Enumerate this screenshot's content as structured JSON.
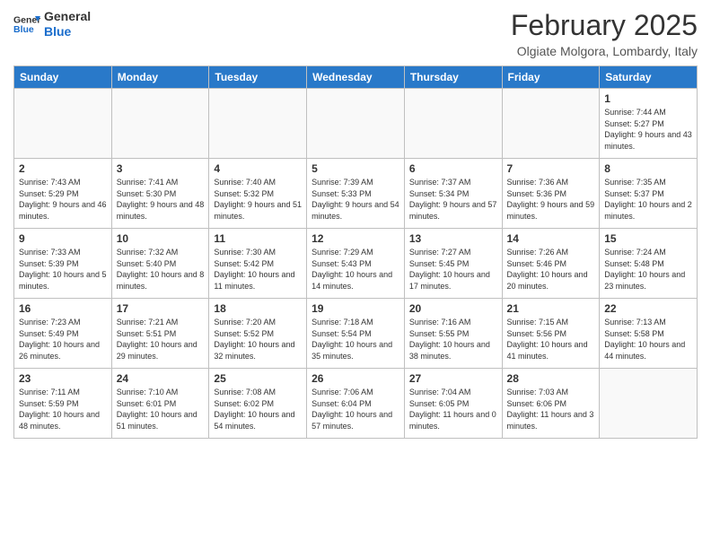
{
  "logo": {
    "general": "General",
    "blue": "Blue"
  },
  "header": {
    "month": "February 2025",
    "location": "Olgiate Molgora, Lombardy, Italy"
  },
  "weekdays": [
    "Sunday",
    "Monday",
    "Tuesday",
    "Wednesday",
    "Thursday",
    "Friday",
    "Saturday"
  ],
  "weeks": [
    [
      {
        "day": "",
        "info": ""
      },
      {
        "day": "",
        "info": ""
      },
      {
        "day": "",
        "info": ""
      },
      {
        "day": "",
        "info": ""
      },
      {
        "day": "",
        "info": ""
      },
      {
        "day": "",
        "info": ""
      },
      {
        "day": "1",
        "info": "Sunrise: 7:44 AM\nSunset: 5:27 PM\nDaylight: 9 hours and 43 minutes."
      }
    ],
    [
      {
        "day": "2",
        "info": "Sunrise: 7:43 AM\nSunset: 5:29 PM\nDaylight: 9 hours and 46 minutes."
      },
      {
        "day": "3",
        "info": "Sunrise: 7:41 AM\nSunset: 5:30 PM\nDaylight: 9 hours and 48 minutes."
      },
      {
        "day": "4",
        "info": "Sunrise: 7:40 AM\nSunset: 5:32 PM\nDaylight: 9 hours and 51 minutes."
      },
      {
        "day": "5",
        "info": "Sunrise: 7:39 AM\nSunset: 5:33 PM\nDaylight: 9 hours and 54 minutes."
      },
      {
        "day": "6",
        "info": "Sunrise: 7:37 AM\nSunset: 5:34 PM\nDaylight: 9 hours and 57 minutes."
      },
      {
        "day": "7",
        "info": "Sunrise: 7:36 AM\nSunset: 5:36 PM\nDaylight: 9 hours and 59 minutes."
      },
      {
        "day": "8",
        "info": "Sunrise: 7:35 AM\nSunset: 5:37 PM\nDaylight: 10 hours and 2 minutes."
      }
    ],
    [
      {
        "day": "9",
        "info": "Sunrise: 7:33 AM\nSunset: 5:39 PM\nDaylight: 10 hours and 5 minutes."
      },
      {
        "day": "10",
        "info": "Sunrise: 7:32 AM\nSunset: 5:40 PM\nDaylight: 10 hours and 8 minutes."
      },
      {
        "day": "11",
        "info": "Sunrise: 7:30 AM\nSunset: 5:42 PM\nDaylight: 10 hours and 11 minutes."
      },
      {
        "day": "12",
        "info": "Sunrise: 7:29 AM\nSunset: 5:43 PM\nDaylight: 10 hours and 14 minutes."
      },
      {
        "day": "13",
        "info": "Sunrise: 7:27 AM\nSunset: 5:45 PM\nDaylight: 10 hours and 17 minutes."
      },
      {
        "day": "14",
        "info": "Sunrise: 7:26 AM\nSunset: 5:46 PM\nDaylight: 10 hours and 20 minutes."
      },
      {
        "day": "15",
        "info": "Sunrise: 7:24 AM\nSunset: 5:48 PM\nDaylight: 10 hours and 23 minutes."
      }
    ],
    [
      {
        "day": "16",
        "info": "Sunrise: 7:23 AM\nSunset: 5:49 PM\nDaylight: 10 hours and 26 minutes."
      },
      {
        "day": "17",
        "info": "Sunrise: 7:21 AM\nSunset: 5:51 PM\nDaylight: 10 hours and 29 minutes."
      },
      {
        "day": "18",
        "info": "Sunrise: 7:20 AM\nSunset: 5:52 PM\nDaylight: 10 hours and 32 minutes."
      },
      {
        "day": "19",
        "info": "Sunrise: 7:18 AM\nSunset: 5:54 PM\nDaylight: 10 hours and 35 minutes."
      },
      {
        "day": "20",
        "info": "Sunrise: 7:16 AM\nSunset: 5:55 PM\nDaylight: 10 hours and 38 minutes."
      },
      {
        "day": "21",
        "info": "Sunrise: 7:15 AM\nSunset: 5:56 PM\nDaylight: 10 hours and 41 minutes."
      },
      {
        "day": "22",
        "info": "Sunrise: 7:13 AM\nSunset: 5:58 PM\nDaylight: 10 hours and 44 minutes."
      }
    ],
    [
      {
        "day": "23",
        "info": "Sunrise: 7:11 AM\nSunset: 5:59 PM\nDaylight: 10 hours and 48 minutes."
      },
      {
        "day": "24",
        "info": "Sunrise: 7:10 AM\nSunset: 6:01 PM\nDaylight: 10 hours and 51 minutes."
      },
      {
        "day": "25",
        "info": "Sunrise: 7:08 AM\nSunset: 6:02 PM\nDaylight: 10 hours and 54 minutes."
      },
      {
        "day": "26",
        "info": "Sunrise: 7:06 AM\nSunset: 6:04 PM\nDaylight: 10 hours and 57 minutes."
      },
      {
        "day": "27",
        "info": "Sunrise: 7:04 AM\nSunset: 6:05 PM\nDaylight: 11 hours and 0 minutes."
      },
      {
        "day": "28",
        "info": "Sunrise: 7:03 AM\nSunset: 6:06 PM\nDaylight: 11 hours and 3 minutes."
      },
      {
        "day": "",
        "info": ""
      }
    ]
  ]
}
